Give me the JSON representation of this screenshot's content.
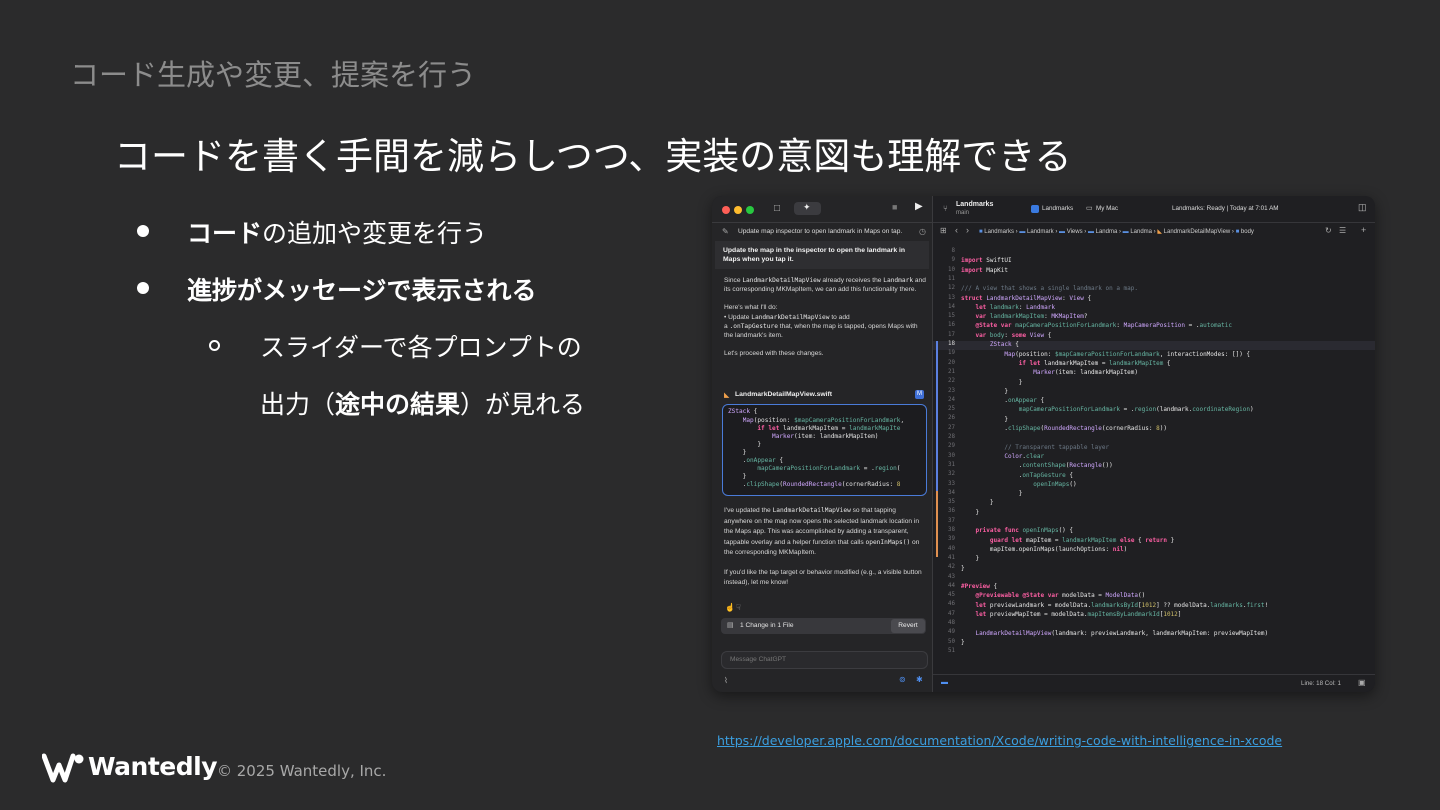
{
  "slide": {
    "section_title": "コード生成や変更、提案を行う",
    "headline": "コードを書く手間を減らしつつ、実装の意図も理解できる",
    "bullets": [
      {
        "text": "コードの追加や変更を行う",
        "bold_prefix": "コード"
      },
      {
        "text": "進捗がメッセージで表示される"
      }
    ],
    "sub_bullet_line1": "スライダーで各プロンプトの",
    "sub_bullet_line2_pre": "出力（",
    "sub_bullet_line2_bold": "途中の結果",
    "sub_bullet_line2_post": "）が見れる",
    "link": "https://developer.apple.com/documentation/Xcode/writing-code-with-intelligence-in-xcode",
    "brand": "Wantedly",
    "copyright": "© 2025 Wantedly, Inc."
  },
  "xcode": {
    "project": "Landmarks",
    "branch": "main",
    "scheme": "Landmarks",
    "destination": "My Mac",
    "status": "Landmarks: Ready | Today at 7:01 AM",
    "breadcrumb": [
      "Landmarks",
      "Landmark",
      "Views",
      "Landma",
      "Landma",
      "LandmarkDetailMapView",
      "body"
    ],
    "cursor_pos": "Line: 18  Col: 1",
    "chat": {
      "header": "Update map inspector to open landmark in Maps on tap.",
      "prompt": "Update the map in the inspector to open the landmark in Maps when you tap it.",
      "p1_a": "Since ",
      "p1_code1": "LandmarkDetailMapView",
      "p1_b": " already receives the ",
      "p1_code2": "Landmark",
      "p1_c": " and its corresponding MKMapItem, we can add this functionality there.",
      "p2": "Here's what I'll do:",
      "p2_item_a": "• Update ",
      "p2_item_code": "LandmarkDetailMapView",
      "p2_item_b": " to add",
      "p2_item_c": "a ",
      "p2_item_code2": ".onTapGesture",
      "p2_item_d": " that, when the map is tapped, opens Maps with the landmark's item.",
      "p3": "Let's proceed with these changes.",
      "file_name": "LandmarkDetailMapView.swift",
      "file_badge": "M",
      "p4_a": "I've updated the ",
      "p4_code": "LandmarkDetailMapView",
      "p4_b": " so that tapping anywhere on the map now opens the selected landmark location in the Maps app. This was accomplished by adding a transparent, tappable overlay and a helper function that calls ",
      "p4_code2": "openInMaps()",
      "p4_c": " on the corresponding MKMapItem.",
      "p5": "If you'd like the tap target or behavior modified (e.g., a visible button instead), let me know!",
      "changes": "1 Change in 1 File",
      "revert": "Revert",
      "input_placeholder": "Message ChatGPT"
    }
  }
}
